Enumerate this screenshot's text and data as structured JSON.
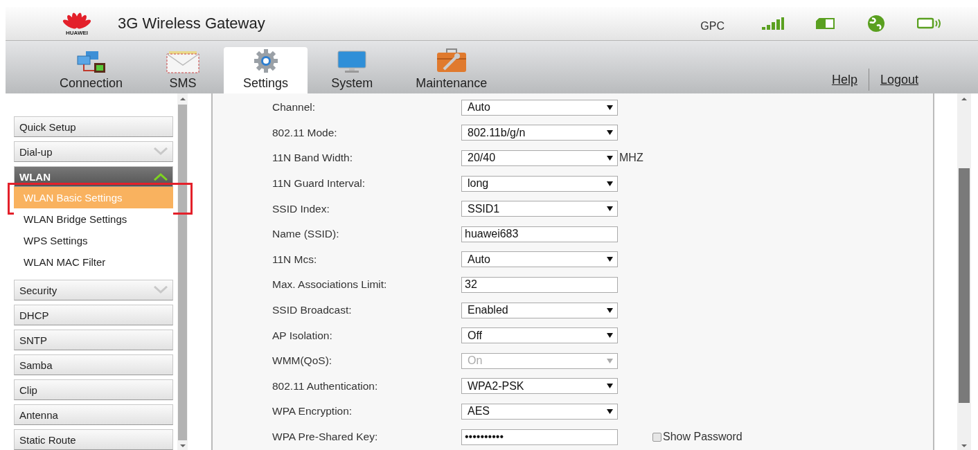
{
  "header": {
    "logo_text": "HUAWEI",
    "title": "3G Wireless Gateway",
    "operator": "GPC"
  },
  "tabs": [
    {
      "label": "Connection",
      "selected": false
    },
    {
      "label": "SMS",
      "selected": false
    },
    {
      "label": "Settings",
      "selected": true
    },
    {
      "label": "System",
      "selected": false
    },
    {
      "label": "Maintenance",
      "selected": false
    }
  ],
  "links": [
    "Help",
    "Logout"
  ],
  "sidebar": {
    "items": [
      {
        "label": "Quick Setup",
        "kind": "item"
      },
      {
        "label": "Dial-up",
        "kind": "group",
        "expanded": false
      },
      {
        "label": "WLAN",
        "kind": "group",
        "expanded": true,
        "children": [
          {
            "label": "WLAN Basic Settings",
            "selected": true,
            "annotated": true
          },
          {
            "label": "WLAN Bridge Settings",
            "selected": false,
            "annotated": false
          },
          {
            "label": "WPS Settings",
            "selected": false,
            "annotated": false
          },
          {
            "label": "WLAN MAC Filter",
            "selected": false,
            "annotated": false
          }
        ]
      },
      {
        "label": "Security",
        "kind": "group",
        "expanded": false
      },
      {
        "label": "DHCP",
        "kind": "item"
      },
      {
        "label": "SNTP",
        "kind": "item"
      },
      {
        "label": "Samba",
        "kind": "item"
      },
      {
        "label": "Clip",
        "kind": "item"
      },
      {
        "label": "Antenna",
        "kind": "item"
      },
      {
        "label": "Static Route",
        "kind": "item"
      }
    ]
  },
  "form": [
    {
      "label": "Channel:",
      "kind": "select",
      "value": "Auto",
      "disabled": false
    },
    {
      "label": "802.11 Mode:",
      "kind": "select",
      "value": "802.11b/g/n",
      "disabled": false
    },
    {
      "label": "11N Band Width:",
      "kind": "select",
      "value": "20/40",
      "disabled": false,
      "suffix": "MHZ"
    },
    {
      "label": "11N Guard Interval:",
      "kind": "select",
      "value": "long",
      "disabled": false
    },
    {
      "label": "SSID Index:",
      "kind": "select",
      "value": "SSID1",
      "disabled": false
    },
    {
      "label": "Name (SSID):",
      "kind": "text",
      "value": "huawei683",
      "disabled": false
    },
    {
      "label": "11N Mcs:",
      "kind": "select",
      "value": "Auto",
      "disabled": false
    },
    {
      "label": "Max. Associations Limit:",
      "kind": "text",
      "value": "32",
      "disabled": false
    },
    {
      "label": "SSID Broadcast:",
      "kind": "select",
      "value": "Enabled",
      "disabled": false
    },
    {
      "label": "AP Isolation:",
      "kind": "select",
      "value": "Off",
      "disabled": false
    },
    {
      "label": "WMM(QoS):",
      "kind": "select",
      "value": "On",
      "disabled": true
    },
    {
      "label": "802.11 Authentication:",
      "kind": "select",
      "value": "WPA2-PSK",
      "disabled": false
    },
    {
      "label": "WPA Encryption:",
      "kind": "select",
      "value": "AES",
      "disabled": false
    },
    {
      "label": "WPA Pre-Shared Key:",
      "kind": "text",
      "value": "••••••••••",
      "disabled": false,
      "checkbox": {
        "label": "Show Password",
        "checked": false
      }
    }
  ]
}
